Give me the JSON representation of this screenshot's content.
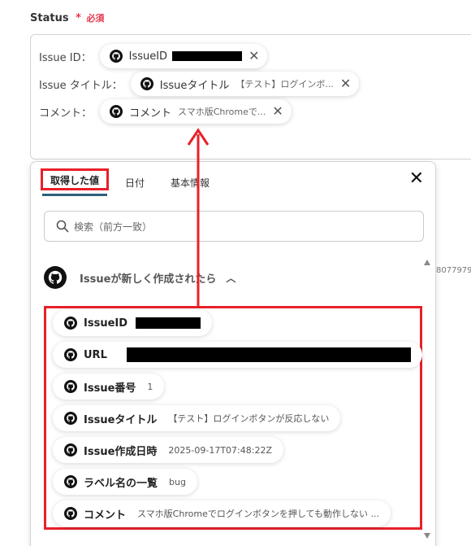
{
  "field": {
    "label": "Status",
    "required_mark": "*",
    "required_text": "必須"
  },
  "editor": {
    "rows": [
      {
        "label": "Issue ID：",
        "chip_text": "IssueID",
        "chip_sub": ""
      },
      {
        "label": "Issue タイトル：",
        "chip_text": "Issueタイトル",
        "chip_sub": "【テスト】ログインボ..."
      },
      {
        "label": "コメント：",
        "chip_text": "コメント",
        "chip_sub": "スマホ版Chromeで..."
      }
    ]
  },
  "panel": {
    "tabs": [
      "取得した値",
      "日付",
      "基本情報"
    ],
    "active_tab": 0,
    "search_placeholder": "検索（前方一致）",
    "group_title": "Issueが新しく作成されたら",
    "items": [
      {
        "label": "IssueID",
        "value": ""
      },
      {
        "label": "URL",
        "value": ""
      },
      {
        "label": "Issue番号",
        "value": "1"
      },
      {
        "label": "Issueタイトル",
        "value": "【テスト】ログインボタンが反応しない"
      },
      {
        "label": "Issue作成日時",
        "value": "2025-09-17T07:48:22Z"
      },
      {
        "label": "ラベル名の一覧",
        "value": "bug"
      },
      {
        "label": "コメント",
        "value": "スマホ版Chromeでログインボタンを押しても動作しない ..."
      }
    ]
  },
  "outside_text": "8077979",
  "colors": {
    "highlight": "#e8202a",
    "required": "#e8364f",
    "tab_underline": "#2d5f7c"
  },
  "icons": {
    "github": "github-icon",
    "close": "close-icon",
    "search": "search-icon",
    "caret": "chevron-up-icon"
  }
}
